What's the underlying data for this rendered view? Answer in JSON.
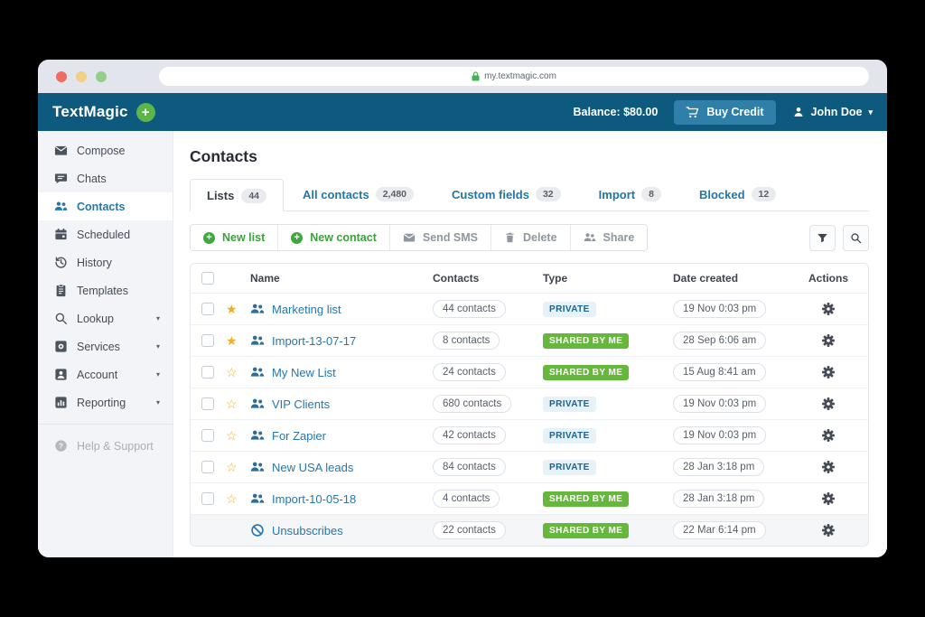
{
  "browser": {
    "url": "my.textmagic.com"
  },
  "appbar": {
    "logo": "TextMagic",
    "logo_plus": "+",
    "balance": "Balance: $80.00",
    "buy_credit": "Buy Credit",
    "user": "John Doe"
  },
  "sidebar": {
    "items": [
      {
        "label": "Compose"
      },
      {
        "label": "Chats"
      },
      {
        "label": "Contacts"
      },
      {
        "label": "Scheduled"
      },
      {
        "label": "History"
      },
      {
        "label": "Templates"
      },
      {
        "label": "Lookup"
      },
      {
        "label": "Services"
      },
      {
        "label": "Account"
      },
      {
        "label": "Reporting"
      },
      {
        "label": "Help & Support"
      }
    ]
  },
  "page": {
    "title": "Contacts"
  },
  "tabs": [
    {
      "label": "Lists",
      "badge": "44"
    },
    {
      "label": "All contacts",
      "badge": "2,480"
    },
    {
      "label": "Custom fields",
      "badge": "32"
    },
    {
      "label": "Import",
      "badge": "8"
    },
    {
      "label": "Blocked",
      "badge": "12"
    }
  ],
  "toolbar": {
    "new_list": "New list",
    "new_contact": "New contact",
    "send_sms": "Send SMS",
    "delete": "Delete",
    "share": "Share",
    "plus": "+"
  },
  "table": {
    "columns": {
      "name": "Name",
      "contacts": "Contacts",
      "type": "Type",
      "date": "Date created",
      "actions": "Actions"
    },
    "rows": [
      {
        "star": "★",
        "name": "Marketing list",
        "contacts": "44 contacts",
        "type": "PRIVATE",
        "type_class": "badge-private",
        "date": "19 Nov 0:03 pm"
      },
      {
        "star": "★",
        "name": "Import-13-07-17",
        "contacts": "8 contacts",
        "type": "SHARED BY ME",
        "type_class": "badge-shared",
        "date": "28 Sep 6:06 am"
      },
      {
        "star": "☆",
        "name": "My New List",
        "contacts": "24 contacts",
        "type": "SHARED BY ME",
        "type_class": "badge-shared",
        "date": "15 Aug 8:41 am"
      },
      {
        "star": "☆",
        "name": "VIP Clients",
        "contacts": "680 contacts",
        "type": "PRIVATE",
        "type_class": "badge-private",
        "date": "19 Nov 0:03 pm"
      },
      {
        "star": "☆",
        "name": "For Zapier",
        "contacts": "42 contacts",
        "type": "PRIVATE",
        "type_class": "badge-private",
        "date": "19 Nov 0:03 pm"
      },
      {
        "star": "☆",
        "name": "New USA leads",
        "contacts": "84 contacts",
        "type": "PRIVATE",
        "type_class": "badge-private",
        "date": "28 Jan 3:18 pm"
      },
      {
        "star": "☆",
        "name": "Import-10-05-18",
        "contacts": "4 contacts",
        "type": "SHARED BY ME",
        "type_class": "badge-shared",
        "date": "28 Jan 3:18 pm"
      },
      {
        "name": "Unsubscribes",
        "contacts": "22 contacts",
        "type": "SHARED BY ME",
        "type_class": "badge-shared",
        "date": "22 Mar 6:14 pm"
      }
    ]
  },
  "colors": {
    "header_teal": "#0d5a7e",
    "accent_green": "#3fa83c",
    "link_blue": "#2577ad",
    "shared_badge_green": "#66b83c",
    "private_badge_bg": "#e7f1f8",
    "private_badge_text": "#19648e",
    "star_yellow": "#f2ae22"
  }
}
